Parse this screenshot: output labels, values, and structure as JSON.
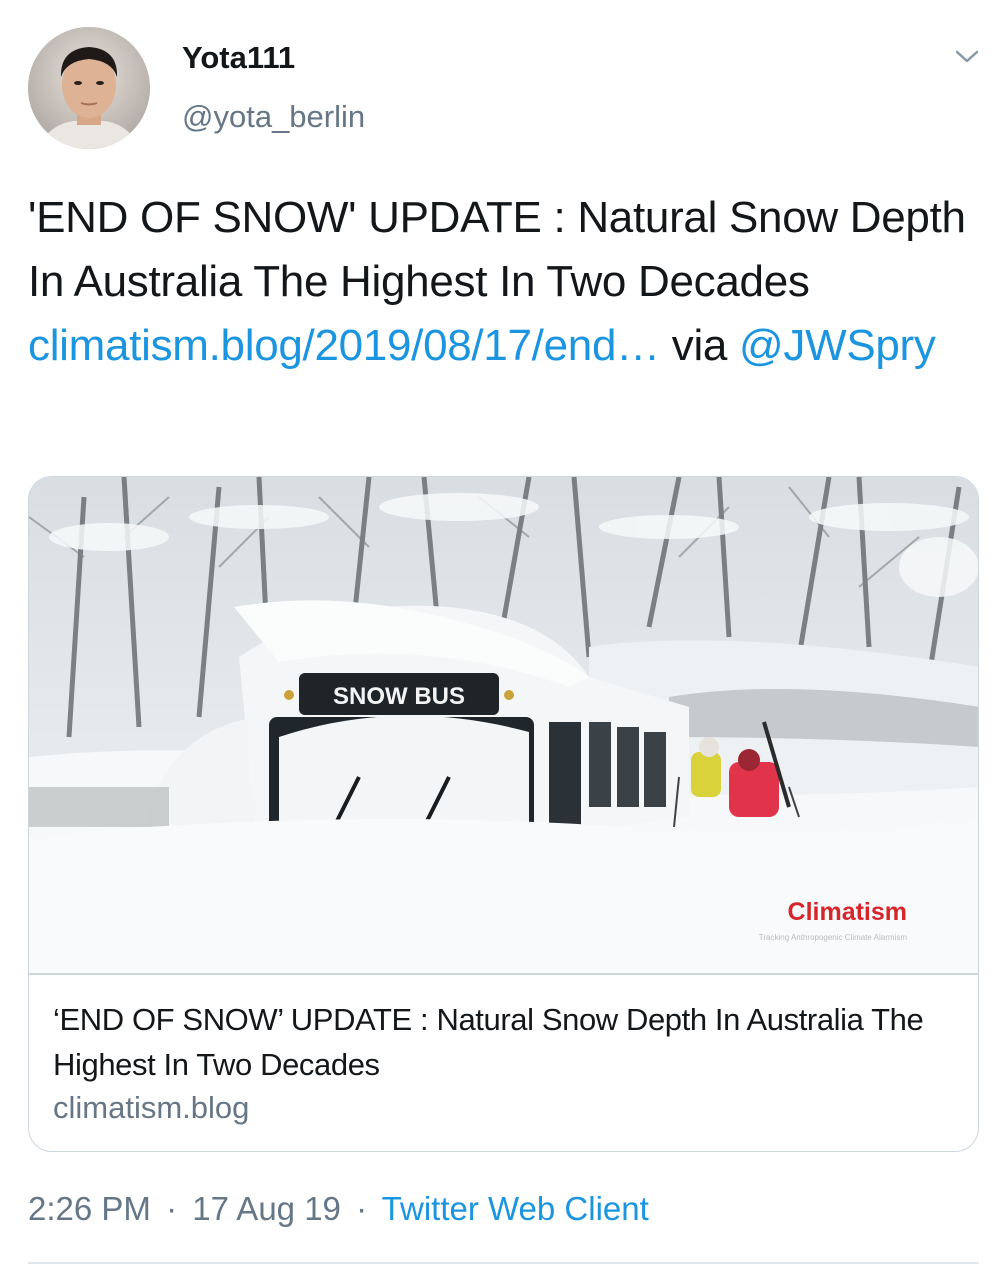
{
  "user": {
    "display_name": "Yota111",
    "handle": "@yota_berlin",
    "avatar_icon": "profile-photo"
  },
  "tweet": {
    "text_main": "'END OF SNOW' UPDATE : Natural Snow Depth In Australia The Highest In Two Decades ",
    "link_url": "climatism.blog/2019/08/17/end…",
    "via_text": " via ",
    "mention": "@JWSpry"
  },
  "card": {
    "image_sign": "SNOW BUS",
    "image_brand": "Climatism",
    "image_brand_tagline": "Tracking Anthropogenic Climate Alarmism",
    "title": "‘END OF SNOW’ UPDATE : Natural Snow Depth In Australia The Highest In Two Decades",
    "domain": "climatism.blog"
  },
  "meta": {
    "time": "2:26 PM",
    "date": "17 Aug 19",
    "source": "Twitter Web Client",
    "separator": "·"
  },
  "colors": {
    "link": "#1b95e0",
    "text": "#14171a",
    "secondary": "#657786",
    "border": "#ccd6dd",
    "brand_red": "#d6262b"
  }
}
